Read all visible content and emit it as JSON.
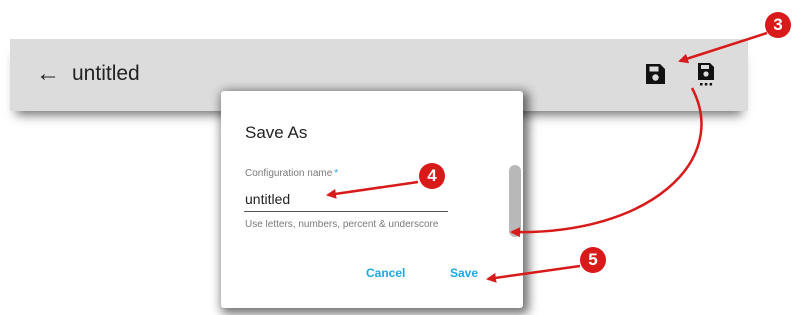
{
  "toolbar": {
    "back_icon": "left-arrow-icon",
    "title": "untitled",
    "save_icon": "floppy-disk-icon",
    "save_as_icon": "floppy-disk-dots-icon"
  },
  "dialog": {
    "title": "Save As",
    "field_label": "Configuration name",
    "required_mark": "*",
    "field_value": "untitled",
    "hint": "Use letters, numbers, percent & underscore",
    "cancel_label": "Cancel",
    "save_label": "Save"
  },
  "callouts": [
    "3",
    "4",
    "5"
  ],
  "colors": {
    "accent": "#1fa8e0",
    "callout_red": "#d81a1a",
    "toolbar_bg": "#dcdcdc"
  }
}
